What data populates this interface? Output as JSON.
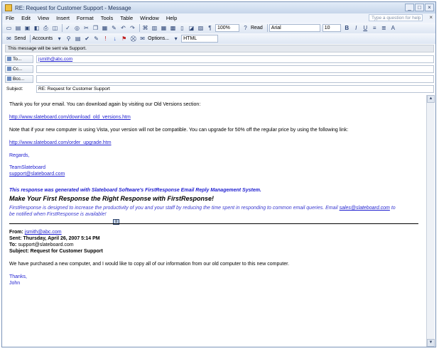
{
  "window": {
    "title": "RE: Request for Customer Support - Message",
    "controls": [
      "_",
      "□",
      "×"
    ]
  },
  "menu": [
    "File",
    "Edit",
    "View",
    "Insert",
    "Format",
    "Tools",
    "Table",
    "Window",
    "Help"
  ],
  "help_box": {
    "placeholder": "Type a question for help"
  },
  "toolbar1": {
    "zoom": "100%",
    "read_label": "Read",
    "font": "Arial",
    "font_size": "10",
    "bold": "B",
    "italic": "I",
    "underline": "U"
  },
  "toolbar2": {
    "send": "Send",
    "accounts": "Accounts",
    "options": "Options...",
    "format": "HTML"
  },
  "infobar": "This message will be sent via Support.",
  "header": {
    "to_label": "To...",
    "to_value": "jsmith@abc.com",
    "cc_label": "Cc...",
    "bcc_label": "Bcc...",
    "subject_label": "Subject:",
    "subject_value": "RE: Request for Customer Support"
  },
  "body": {
    "line1": "Thank you for your email.  You can download again by visiting our Old Versions section:",
    "link1": "http://www.slateboard.com/download_old_versions.htm",
    "line2": "Note that if your new computer is using Vista, your version will not be compatible.  You can upgrade for 50% off the regular price by using the following link:",
    "link2": "http://www.slateboard.com/order_upgrade.htm",
    "regards": "Regards,",
    "team": "TeamSlateboard",
    "support_email": "support@slateboard.com",
    "generated": "This response was generated with Slateboard Software's FirstResponse Email Reply Management System.",
    "headline": "Make Your First Response the Right Response with FirstResponse!",
    "promo1": "FirstResponse is designed to increase the productivity of you and your staff by reducing the time spent in responding to common email queries.  Email ",
    "promo_email": "sales@slateboard.com",
    "promo1_end": "  to",
    "promo2": "be notified when FirstResponse is available!",
    "from_label": "From:",
    "from_value": "jsmith@abc.com",
    "sent_label": "Sent:",
    "sent_value": "Thursday, April 26, 2007 5:14 PM",
    "to_label": "To:",
    "to_value": "support@slateboard.com",
    "subject_label": "Subject:",
    "subject_value": "Request for Customer Support",
    "quoted": "We have purchased a new computer, and I would like to copy all of our information from our old computer to this new computer.",
    "thanks": "Thanks,",
    "name": "John"
  },
  "scroll": {
    "up": "▲",
    "down": "▼"
  }
}
